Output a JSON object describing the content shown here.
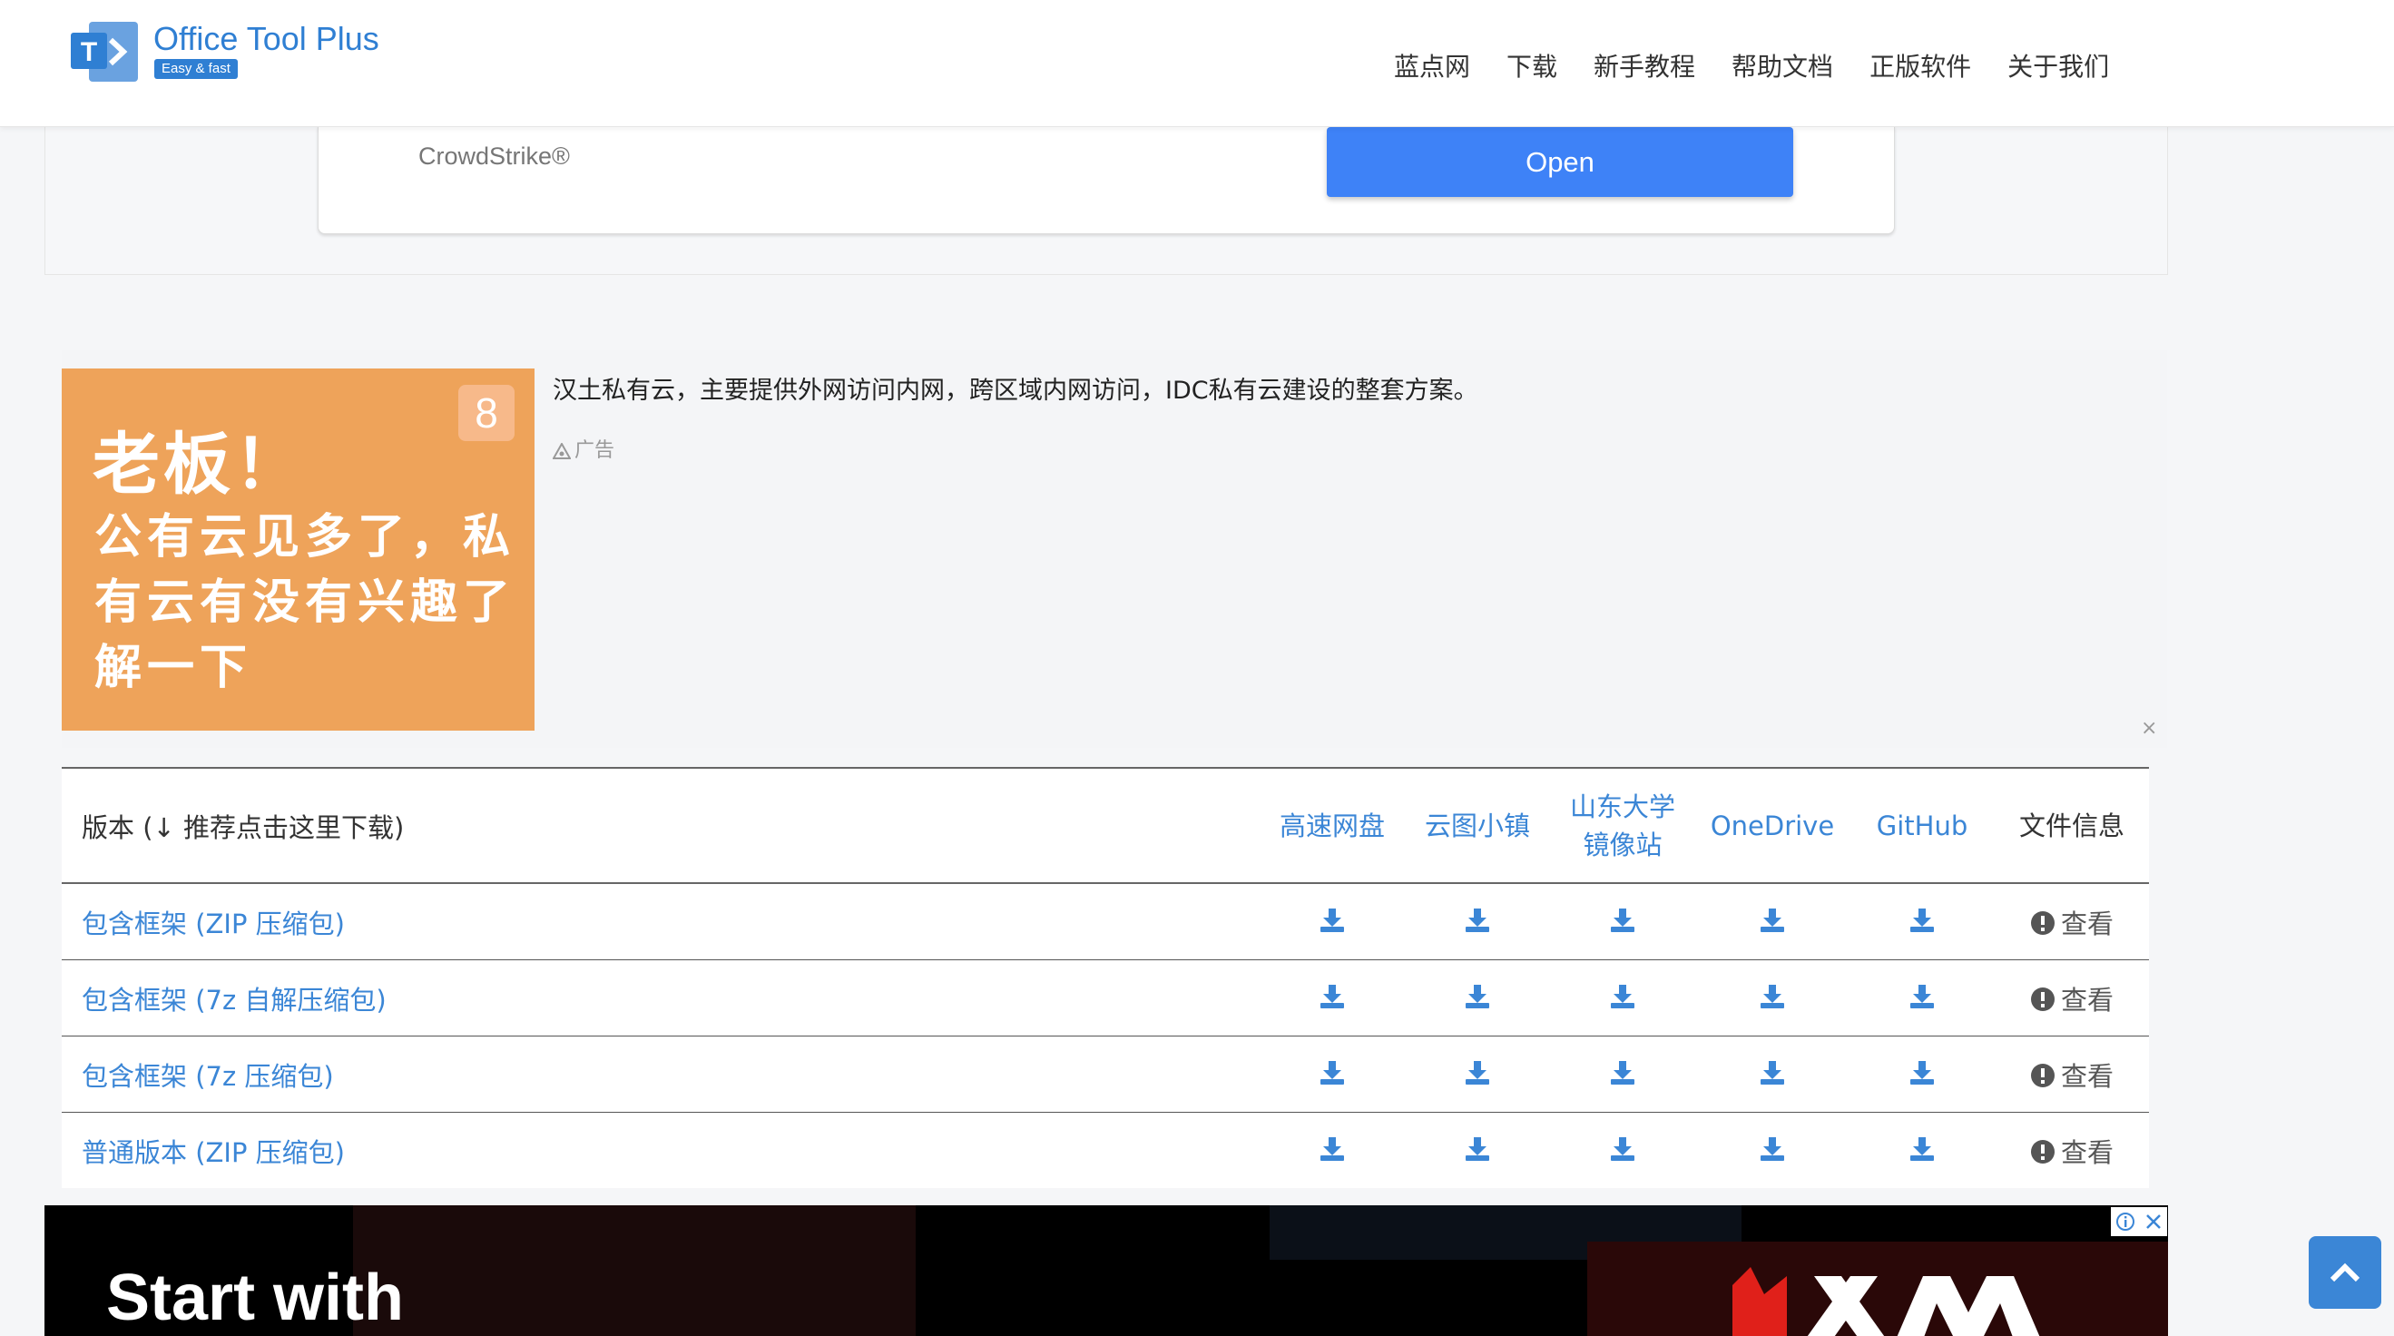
{
  "header": {
    "brand_name": "Office Tool Plus",
    "brand_tagline": "Easy & fast",
    "logo_letter": "T",
    "nav": [
      "蓝点网",
      "下载",
      "新手教程",
      "帮助文档",
      "正版软件",
      "关于我们"
    ]
  },
  "top_ad": {
    "advertiser": "CrowdStrike®",
    "button_label": "Open"
  },
  "native_ad": {
    "image_badge": "8",
    "image_headline": "老板！",
    "image_body": "公有云见多了，私有云有没有兴趣了解一下",
    "text": "汉土私有云，主要提供外网访问内网，跨区域内网访问，IDC私有云建设的整套方案。",
    "label": "广告",
    "close": "×"
  },
  "downloads": {
    "header": {
      "name": "版本 (↓ 推荐点击这里下载)",
      "columns": [
        "高速网盘",
        "云图小镇",
        "山东大学\n镜像站",
        "OneDrive",
        "GitHub",
        "文件信息"
      ]
    },
    "info_label": "查看",
    "rows": [
      {
        "name": "包含框架 (ZIP 压缩包)"
      },
      {
        "name": "包含框架 (7z 自解压缩包)"
      },
      {
        "name": "包含框架 (7z 压缩包)"
      },
      {
        "name": "普通版本 (ZIP 压缩包)"
      }
    ]
  },
  "banner": {
    "text": "Start with"
  },
  "colors": {
    "brand": "#2f7fd3",
    "link": "#3b86d6",
    "ad_button": "#3e82f7",
    "ad_orange": "#eea35a"
  }
}
